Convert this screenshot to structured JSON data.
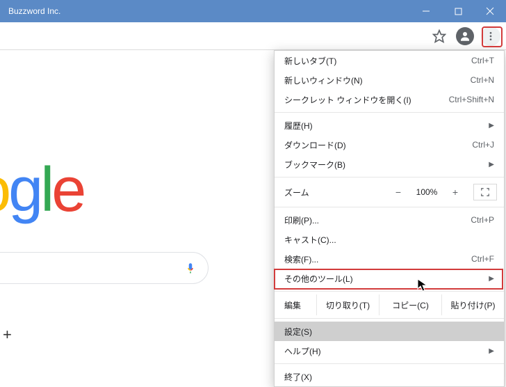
{
  "window": {
    "title": "Buzzword Inc."
  },
  "logo": {
    "g1": "o",
    "g2": "g",
    "g3": "l",
    "g4": "e"
  },
  "menu": {
    "new_tab": {
      "label": "新しいタブ(T)",
      "accel": "Ctrl+T"
    },
    "new_window": {
      "label": "新しいウィンドウ(N)",
      "accel": "Ctrl+N"
    },
    "incognito": {
      "label": "シークレット ウィンドウを開く(I)",
      "accel": "Ctrl+Shift+N"
    },
    "history": {
      "label": "履歴(H)"
    },
    "downloads": {
      "label": "ダウンロード(D)",
      "accel": "Ctrl+J"
    },
    "bookmarks": {
      "label": "ブックマーク(B)"
    },
    "zoom": {
      "label": "ズーム",
      "minus": "−",
      "value": "100%",
      "plus": "+"
    },
    "print": {
      "label": "印刷(P)...",
      "accel": "Ctrl+P"
    },
    "cast": {
      "label": "キャスト(C)..."
    },
    "find": {
      "label": "検索(F)...",
      "accel": "Ctrl+F"
    },
    "more_tools": {
      "label": "その他のツール(L)"
    },
    "edit": {
      "label": "編集",
      "cut": "切り取り(T)",
      "copy": "コピー(C)",
      "paste": "貼り付け(P)"
    },
    "settings": {
      "label": "設定(S)"
    },
    "help": {
      "label": "ヘルプ(H)"
    },
    "exit": {
      "label": "終了(X)"
    }
  }
}
